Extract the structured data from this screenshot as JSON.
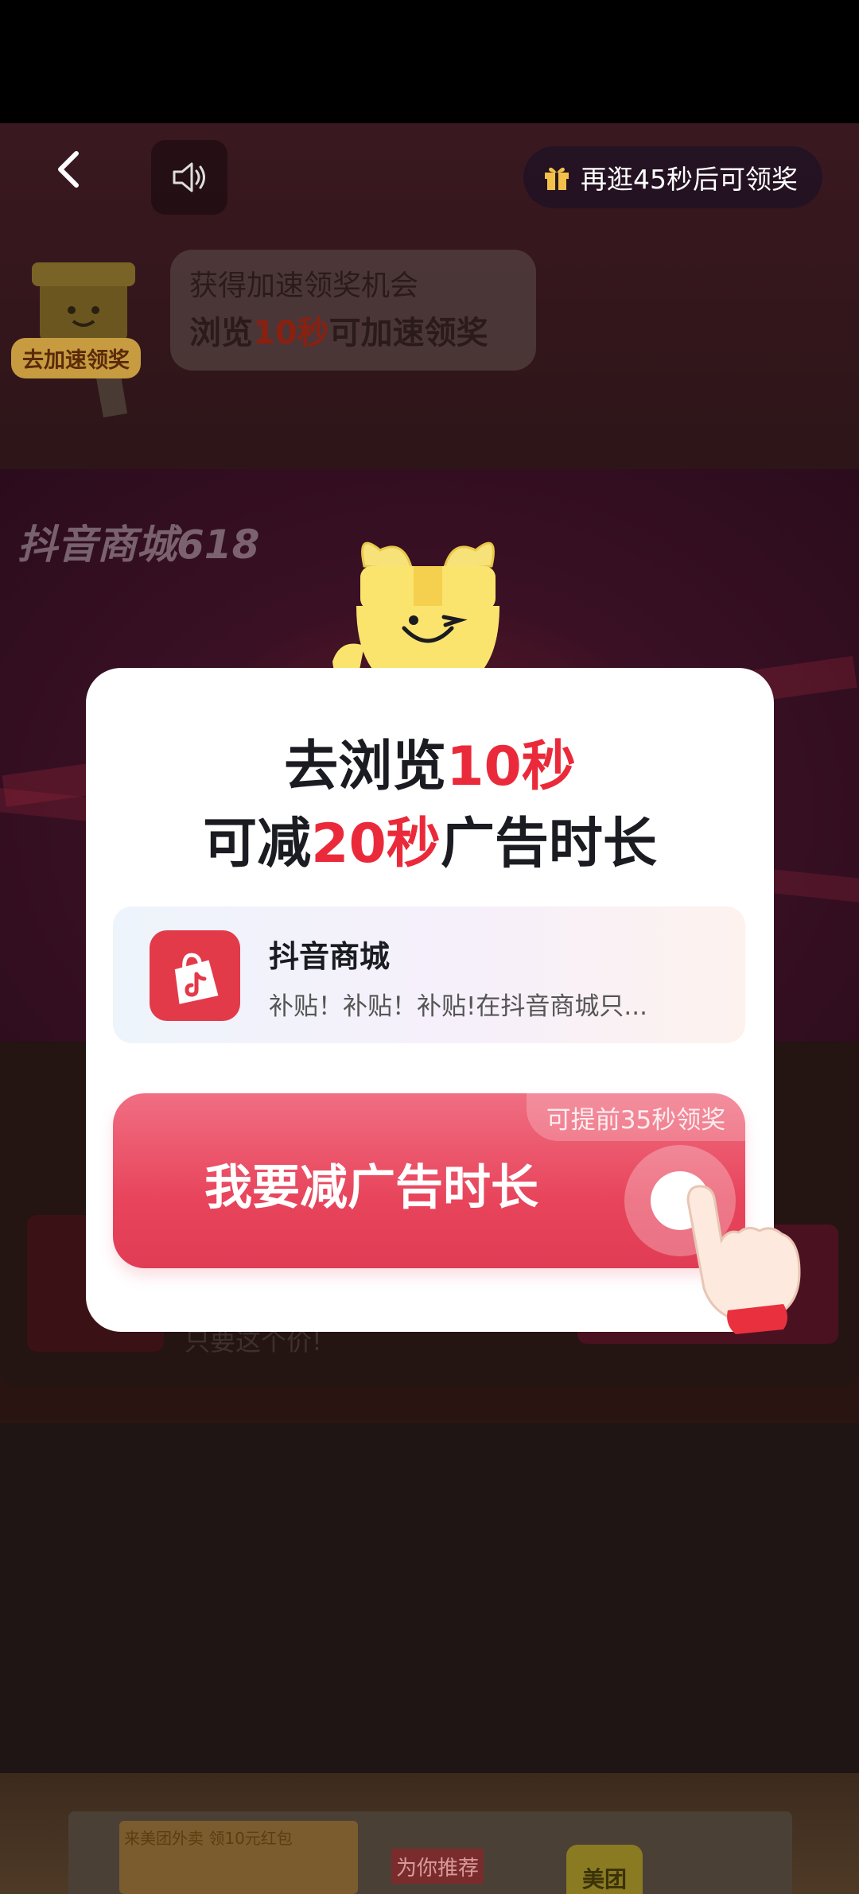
{
  "header": {
    "reward_countdown": "再逛45秒后可领奖"
  },
  "speed_tip": {
    "badge": "去加速领奖",
    "line1": "获得加速领奖机会",
    "line2_prefix": "浏览",
    "line2_highlight": "10秒",
    "line2_suffix": "可加速领奖"
  },
  "banner": {
    "title": "抖音商城618"
  },
  "list": {
    "item_text": "只要这个价!"
  },
  "bottom_ad": {
    "food_text": "来美团外卖 领10元红包",
    "recommend": "为你推荐",
    "brand": "美团"
  },
  "modal": {
    "title_line1_prefix": "去浏览",
    "title_line1_highlight": "10秒",
    "title_line2_prefix": "可减",
    "title_line2_highlight": "20秒",
    "title_line2_suffix": "广告时长",
    "app_name": "抖音商城",
    "app_desc": "补贴！补贴！补贴!在抖音商城只...",
    "cta_tag": "可提前35秒领奖",
    "cta_label": "我要减广告时长"
  },
  "colors": {
    "accent_red": "#ea2a3a",
    "cta_pink": "#e8455c"
  }
}
